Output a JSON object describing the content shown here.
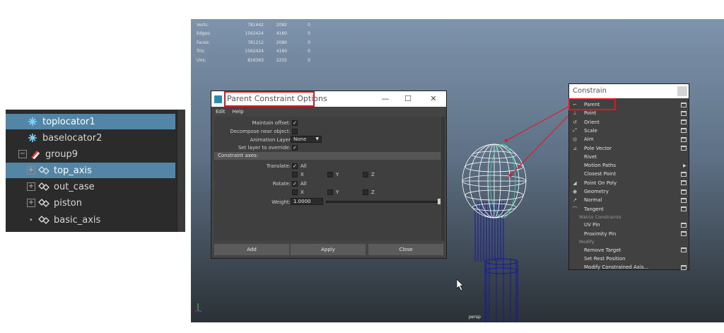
{
  "outliner": {
    "items": [
      {
        "label": "toplocator1",
        "icon": "locator-icon",
        "selected": true
      },
      {
        "label": "baselocator2",
        "icon": "locator-icon",
        "selected": false
      },
      {
        "label": "group9",
        "icon": "group-icon",
        "selected": false,
        "expander": "minus"
      },
      {
        "label": "top_axis",
        "icon": "transform-icon",
        "selected": true,
        "expander": "plus"
      },
      {
        "label": "out_case",
        "icon": "transform-icon",
        "selected": false,
        "expander": "plus"
      },
      {
        "label": "piston",
        "icon": "transform-icon",
        "selected": false,
        "expander": "plus"
      },
      {
        "label": "basic_axis",
        "icon": "transform-icon",
        "selected": false
      }
    ]
  },
  "viewport": {
    "camera_label": "persp",
    "hud": [
      {
        "label": "Verts:",
        "v1": "781442",
        "v2": "2082",
        "v3": "0"
      },
      {
        "label": "Edges:",
        "v1": "1562424",
        "v2": "4160",
        "v3": "0"
      },
      {
        "label": "Faces:",
        "v1": "781212",
        "v2": "2080",
        "v3": "0"
      },
      {
        "label": "Tris:",
        "v1": "1562424",
        "v2": "4160",
        "v3": "0"
      },
      {
        "label": "UVs:",
        "v1": "816363",
        "v2": "2255",
        "v3": "0"
      }
    ],
    "colors": {
      "wire": "#ffffff",
      "selected_wire": "#3ad6a4",
      "shaft": "#141aa0",
      "highlight": "#e8141b"
    }
  },
  "dialog": {
    "title": "Parent Constraint Options",
    "menus": [
      "Edit",
      "Help"
    ],
    "maintain_offset_label": "Maintain offset:",
    "decompose_label": "Decompose near object:",
    "animation_layer_label": "Animation Layer",
    "animation_layer_value": "None",
    "set_layer_label": "Set layer to override:",
    "section_label": "Constraint axes:",
    "translate_label": "Translate:",
    "rotate_label": "Rotate:",
    "all_label": "All",
    "axes": [
      "X",
      "Y",
      "Z"
    ],
    "weight_label": "Weight:",
    "weight_value": "1.0000",
    "buttons": {
      "add": "Add",
      "apply": "Apply",
      "close": "Close"
    }
  },
  "constrain_menu": {
    "title": "Constrain",
    "items": [
      {
        "label": "Parent",
        "icon": "parent-icon",
        "option_box": true
      },
      {
        "label": "Point",
        "icon": "point-icon",
        "option_box": true
      },
      {
        "label": "Orient",
        "icon": "orient-icon",
        "option_box": true
      },
      {
        "label": "Scale",
        "icon": "scale-icon",
        "option_box": true
      },
      {
        "label": "Aim",
        "icon": "aim-icon",
        "option_box": true
      },
      {
        "label": "Pole Vector",
        "icon": "pole-vector-icon",
        "option_box": true
      },
      {
        "label": "Rivet",
        "icon": "",
        "option_box": false
      },
      {
        "label": "Motion Paths",
        "icon": "",
        "submenu": true
      },
      {
        "label": "Closest Point",
        "icon": "",
        "option_box": true
      },
      {
        "label": "Point On Poly",
        "icon": "point-on-poly-icon",
        "option_box": true
      },
      {
        "label": "Geometry",
        "icon": "geometry-icon",
        "option_box": true
      },
      {
        "label": "Normal",
        "icon": "normal-icon",
        "option_box": true
      },
      {
        "label": "Tangent",
        "icon": "tangent-icon",
        "option_box": true
      },
      {
        "section": "Matrix Constraints"
      },
      {
        "label": "UV Pin",
        "icon": "",
        "option_box": true
      },
      {
        "label": "Proximity Pin",
        "icon": "",
        "option_box": true
      },
      {
        "section": "Modify"
      },
      {
        "label": "Remove Target",
        "icon": "",
        "option_box": true
      },
      {
        "label": "Set Rest Position",
        "icon": "",
        "option_box": false
      },
      {
        "label": "Modify Constrained Axis...",
        "icon": "",
        "option_box": true
      }
    ]
  }
}
